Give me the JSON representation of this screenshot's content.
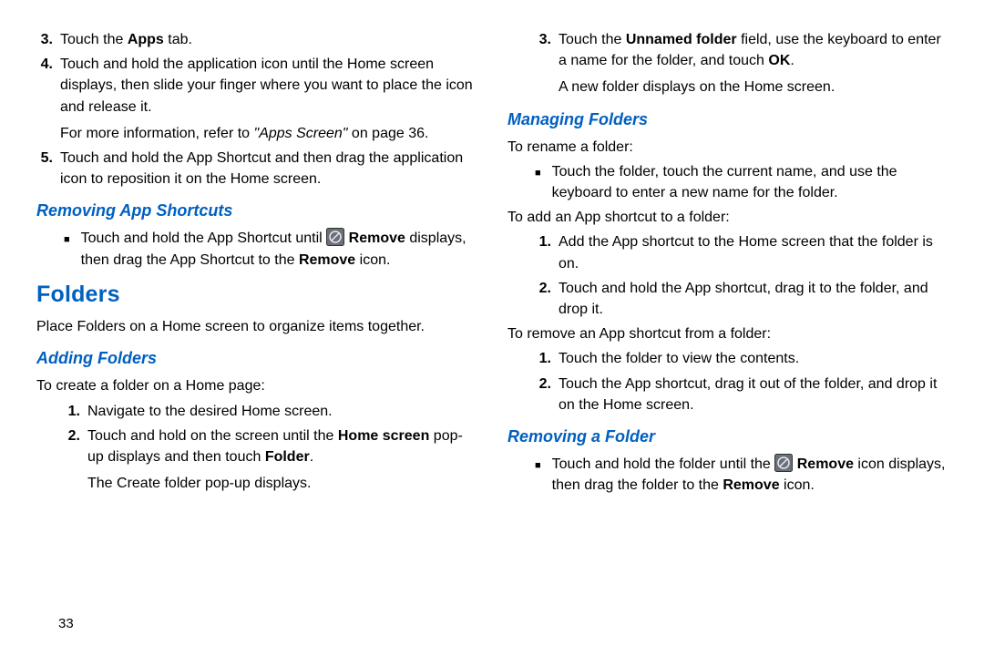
{
  "left": {
    "steps": [
      {
        "n": "3.",
        "pre": "Touch the ",
        "bold": "Apps",
        "post": " tab."
      },
      {
        "n": "4.",
        "text": "Touch and hold the application icon until the Home screen displays, then slide your finger where you want to place the icon and release it.",
        "sub_pre": "For more information, refer to ",
        "sub_italic": "\"Apps Screen\"",
        "sub_post": " on page 36."
      },
      {
        "n": "5.",
        "text": "Touch and hold the App Shortcut and then drag the application icon to reposition it on the Home screen."
      }
    ],
    "h3_removing": "Removing App Shortcuts",
    "removing_bullet": {
      "pre": "Touch and hold the App Shortcut until ",
      "bold1": "Remove",
      "mid": " displays, then drag the App Shortcut to the ",
      "bold2": "Remove",
      "post": " icon."
    },
    "h2_folders": "Folders",
    "folders_intro": "Place Folders on a Home screen to organize items together.",
    "h3_adding": "Adding Folders",
    "adding_intro": "To create a folder on a Home page:",
    "adding_steps": [
      {
        "n": "1.",
        "text": "Navigate to the desired Home screen."
      },
      {
        "n": "2.",
        "pre": "Touch and hold on the screen until the ",
        "bold": "Home screen",
        "mid": " pop-up displays and then touch ",
        "bold2": "Folder",
        "post": ".",
        "sub": "The Create folder pop-up displays."
      }
    ],
    "pagenum": "33"
  },
  "right": {
    "step3": {
      "n": "3.",
      "pre": "Touch the ",
      "bold1": "Unnamed folder",
      "mid": " field, use the keyboard to enter a name for the folder, and touch ",
      "bold2": "OK",
      "post": ".",
      "sub": "A new folder displays on the Home screen."
    },
    "h3_managing": "Managing Folders",
    "rename_intro": "To rename a folder:",
    "rename_bullet": "Touch the folder, touch the current name, and use the keyboard to enter a new name for the folder.",
    "add_intro": "To add an App shortcut to a folder:",
    "add_steps": [
      {
        "n": "1.",
        "text": "Add the App shortcut to the Home screen that the folder is on."
      },
      {
        "n": "2.",
        "text": "Touch and hold the App shortcut, drag it to the folder, and drop it."
      }
    ],
    "remove_intro": "To remove an App shortcut from a folder:",
    "remove_steps": [
      {
        "n": "1.",
        "text": "Touch the folder to view the contents."
      },
      {
        "n": "2.",
        "text": "Touch the App shortcut, drag it out of the folder, and drop it on the Home screen."
      }
    ],
    "h3_removing_folder": "Removing a Folder",
    "removing_folder_bullet": {
      "pre": "Touch and hold the folder until the ",
      "bold1": "Remove",
      "mid": " icon displays, then drag the folder to the ",
      "bold2": "Remove",
      "post": " icon."
    }
  }
}
